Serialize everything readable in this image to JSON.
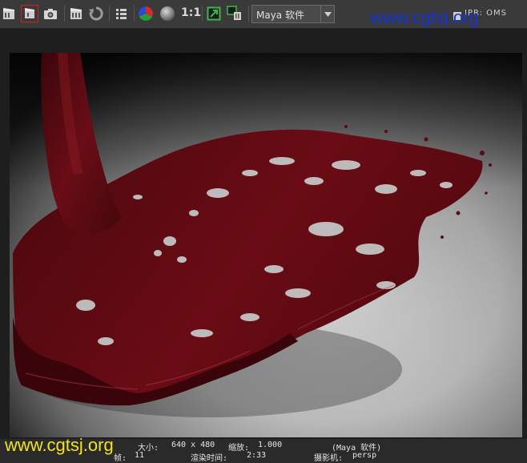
{
  "toolbar": {
    "buttons": [
      {
        "name": "render-icon",
        "label": "render"
      },
      {
        "name": "render-region-icon",
        "label": "render region",
        "active": true
      },
      {
        "name": "snapshot-icon",
        "label": "snapshot"
      },
      {
        "name": "ipr-render-icon",
        "label": "IPR render"
      },
      {
        "name": "refresh-icon",
        "label": "refresh"
      },
      {
        "name": "render-settings-icon",
        "label": "render settings"
      },
      {
        "name": "rgb-channels-icon",
        "label": "RGB channels"
      },
      {
        "name": "alpha-channel-icon",
        "label": "alpha channel"
      },
      {
        "name": "keep-image-icon",
        "label": "keep image"
      },
      {
        "name": "remove-image-icon",
        "label": "remove image"
      }
    ],
    "ratio_label": "1:1",
    "renderer": "Maya 软件",
    "ipr_label": "IPR: OMS"
  },
  "watermark": {
    "top": "www.cgtsj.org",
    "bottom": "www.cgtsj.org"
  },
  "render": {
    "subject": "blood-red liquid splash on grey floor"
  },
  "status": {
    "size_label": "大小:",
    "size_value": "640 x 480",
    "zoom_label": "缩放:",
    "zoom_value": "1.000",
    "renderer_paren": "(Maya 软件)",
    "frame_label": "帧:",
    "frame_value": "11",
    "render_time_label": "渲染时间:",
    "render_time_value": "2:33",
    "camera_label": "摄影机:",
    "camera_value": "persp"
  },
  "colors": {
    "toolbar_bg": "#3a3a3a",
    "liquid": "#5a0a12",
    "watermark_top": "#1533d8",
    "watermark_bottom": "#f2e41a"
  }
}
